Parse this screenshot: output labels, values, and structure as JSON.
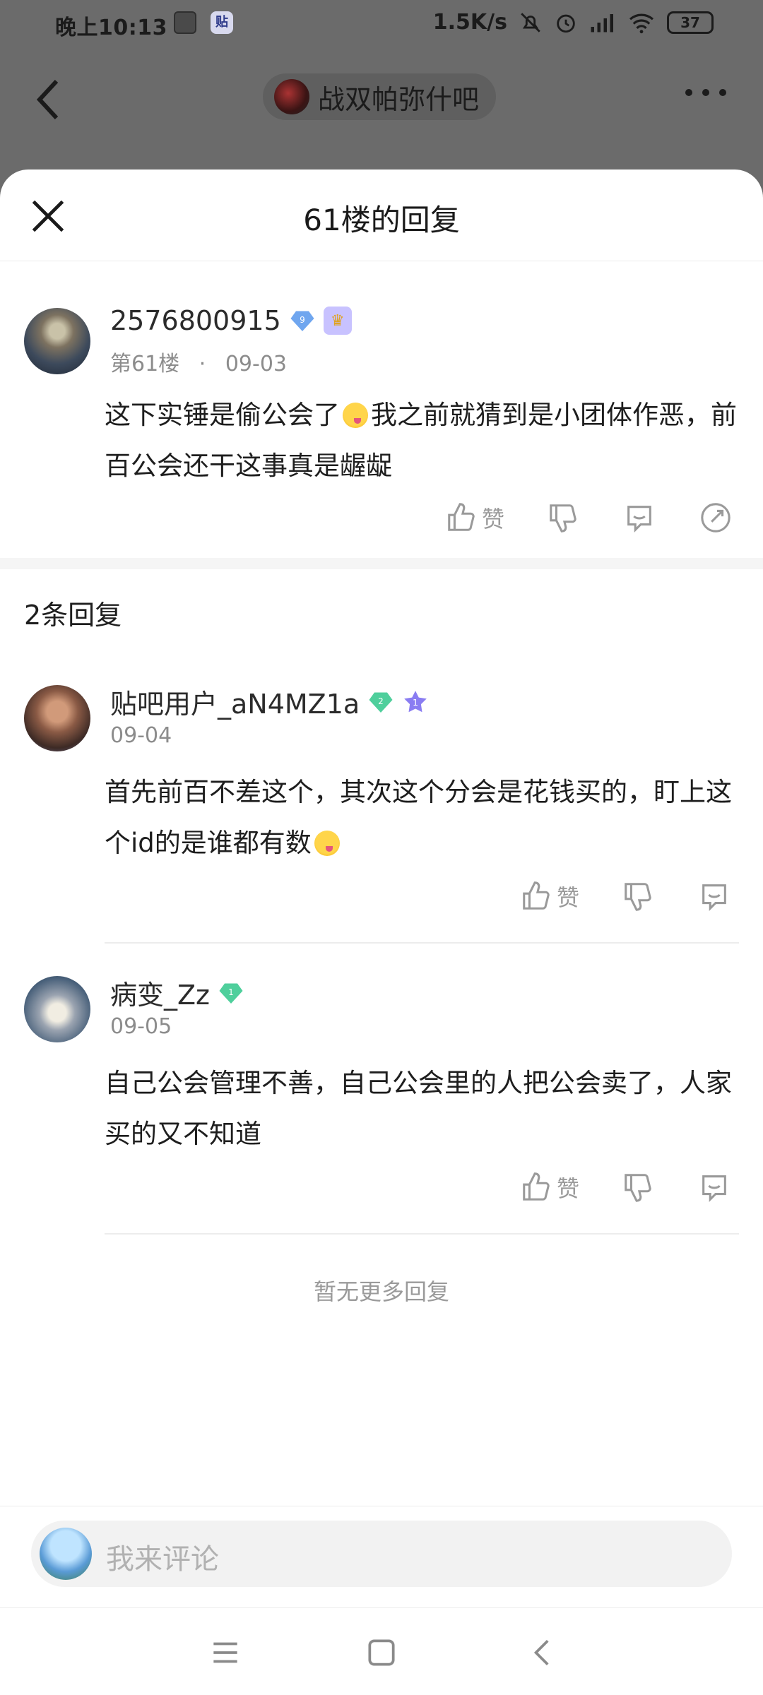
{
  "status_bar": {
    "time": "晚上10:13",
    "app_badge": "贴",
    "net_speed": "1.5K/s",
    "battery": "37"
  },
  "background_page": {
    "forum_title": "战双帕弥什吧"
  },
  "sheet": {
    "title": "61楼的回复"
  },
  "main_post": {
    "username": "2576800915",
    "level": "9",
    "floor": "第61楼",
    "separator": "·",
    "date": "09-03",
    "content_part1": "这下实锤是偷公会了",
    "content_part2": "我之前就猜到是小团体作恶，前百公会还干这事真是龌龊",
    "like_label": "赞"
  },
  "reply_count": "2条回复",
  "replies": [
    {
      "username": "贴吧用户_aN4MZ1a",
      "level": "2",
      "star_level": "1",
      "date": "09-04",
      "content_part1": "首先前百不差这个，其次这个分会是花钱买的，盯上这个id的是谁都有数",
      "like_label": "赞"
    },
    {
      "username": "病变_Zz",
      "level": "1",
      "date": "09-05",
      "content_part1": "自己公会管理不善，自己公会里的人把公会卖了，人家买的又不知道",
      "like_label": "赞"
    }
  ],
  "no_more": "暂无更多回复",
  "composer": {
    "placeholder": "我来评论"
  },
  "colors": {
    "accent_blue": "#6fa6ef",
    "accent_green": "#4fcf9c",
    "muted": "#9a9a9a"
  }
}
